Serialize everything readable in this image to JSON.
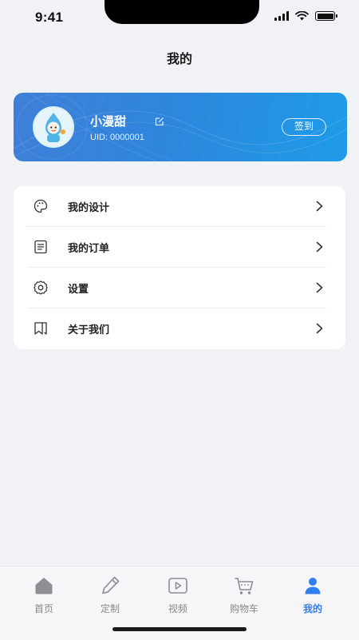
{
  "status_bar": {
    "time": "9:41"
  },
  "header": {
    "title": "我的"
  },
  "profile": {
    "username": "小漫甜",
    "uid": "UID: 0000001",
    "checkin_label": "签到",
    "accent": "#2e86dc"
  },
  "menu": {
    "items": [
      {
        "label": "我的设计",
        "icon": "palette-icon"
      },
      {
        "label": "我的订单",
        "icon": "order-list-icon"
      },
      {
        "label": "设置",
        "icon": "gear-icon"
      },
      {
        "label": "关于我们",
        "icon": "bookmark-icon"
      }
    ]
  },
  "tabbar": {
    "active_color": "#2f7ff0",
    "items": [
      {
        "label": "首页",
        "icon": "home-icon"
      },
      {
        "label": "定制",
        "icon": "pen-icon"
      },
      {
        "label": "视频",
        "icon": "video-play-icon"
      },
      {
        "label": "购物车",
        "icon": "cart-icon"
      },
      {
        "label": "我的",
        "icon": "user-icon"
      }
    ]
  }
}
